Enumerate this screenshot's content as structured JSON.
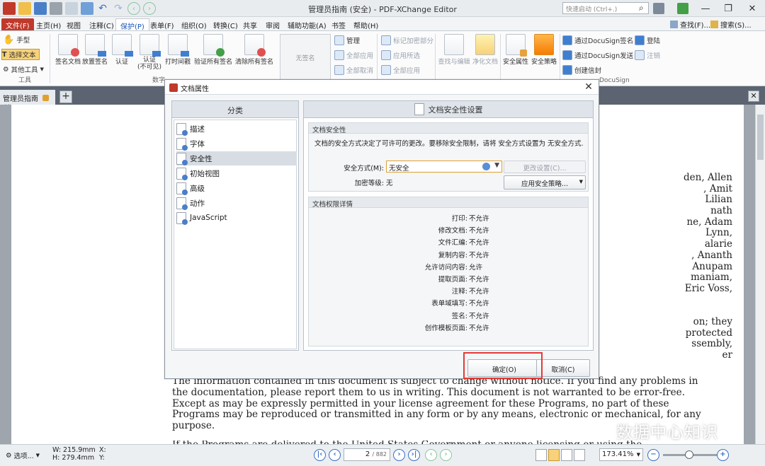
{
  "window": {
    "title": "管理员指南 (安全) - PDF-XChange Editor",
    "quick_search_placeholder": "快速启动 (Ctrl+.)"
  },
  "menu": {
    "items": [
      "文件(F)",
      "主页(H)",
      "视图",
      "注释(C)",
      "保护(P)",
      "表单(F)",
      "组织(O)",
      "转换(C)",
      "共享",
      "审阅",
      "辅助功能(A)",
      "书签",
      "帮助(H)"
    ],
    "active": "保护(P)",
    "find_label": "查找(F)...",
    "search_label": "搜索(S)..."
  },
  "ribbon": {
    "tools": {
      "hand": "手型",
      "select_text": "选择文本",
      "other_tools": "其他工具",
      "group": "工具"
    },
    "sign": {
      "sign_doc": "签名文档",
      "place_sig": "放置签名",
      "certify": "认证",
      "certify_invisible_1": "认证",
      "certify_invisible_2": "(不可见)",
      "timestamp": "打时间戳",
      "verify_all": "验证所有签名",
      "clear_all": "清除所有签名",
      "group": "数字"
    },
    "no_signature": "无签名",
    "manage": {
      "manage": "管理",
      "apply_all": "全部应用",
      "cancel_all": "全部取消"
    },
    "redact": {
      "mark": "标记加密部分",
      "apply_selected": "应用所选",
      "apply_all": "全部应用"
    },
    "find_edit": "查找与编辑",
    "sanitize": "净化文档",
    "security_props": "安全属性",
    "security_policy": "安全策略",
    "docusign": {
      "sign": "通过DocuSign签名",
      "send": "通过DocuSign发送",
      "create_envelope": "创建信封",
      "login": "登陆",
      "logout": "注销",
      "group": "DocuSign"
    }
  },
  "doc_tab": {
    "label": "管理员指南"
  },
  "document": {
    "side_lines": [
      "den, Allen",
      ", Amit",
      "Lilian",
      "nath",
      "ne, Adam",
      "Lynn,",
      "alarie",
      ", Ananth",
      "Anupam",
      "maniam,",
      "Eric Voss,",
      "",
      "",
      "on; they",
      "protected",
      "ssembly,",
      "er"
    ],
    "body_lines": [
      "The information contained in this document is subject to change without notice. If you find any problems in",
      "the documentation, please report them to us in writing. This document is not warranted to be error-free.",
      "Except as may be expressly permitted in your license agreement for these Programs, no part of these",
      "Programs may be reproduced or transmitted in any form or by any means, electronic or mechanical, for any",
      "purpose."
    ],
    "cut_line": "If the Programs are delivered to the United States Government or anyone licensing or using the Programs on"
  },
  "dialog": {
    "title": "文档属性",
    "category_header": "分类",
    "categories": [
      "描述",
      "字体",
      "安全性",
      "初始视图",
      "高级",
      "动作",
      "JavaScript"
    ],
    "selected_category": "安全性",
    "main_header": "文档安全性设置",
    "security": {
      "section_title": "文档安全性",
      "description": "文档的安全方式决定了可许可的更改。要移除安全限制，请将 安全方式设置为 无安全方式.",
      "method_label": "安全方式(M):",
      "method_value": "无安全",
      "encryption_label": "加密等级:",
      "encryption_value": "无",
      "change_settings": "更改设置(C)...",
      "apply_policy": "应用安全策略..."
    },
    "permissions": {
      "section_title": "文档权限详情",
      "rows": [
        {
          "key": "打印:",
          "value": "不允许"
        },
        {
          "key": "修改文档:",
          "value": "不允许"
        },
        {
          "key": "文件汇编:",
          "value": "不允许"
        },
        {
          "key": "复制内容:",
          "value": "不允许"
        },
        {
          "key": "允许访问内容:",
          "value": "允许"
        },
        {
          "key": "提取页面:",
          "value": "不允许"
        },
        {
          "key": "注释:",
          "value": "不允许"
        },
        {
          "key": "表单域填写:",
          "value": "不允许"
        },
        {
          "key": "签名:",
          "value": "不允许"
        },
        {
          "key": "创作模板页面:",
          "value": "不允许"
        }
      ]
    },
    "ok": "确定(O)",
    "cancel": "取消(C)"
  },
  "status": {
    "options": "选项...",
    "width": "W: 215.9mm",
    "height": "H: 279.4mm",
    "x": "X:",
    "y": "Y:",
    "page_current": "2",
    "page_total": "/ 882",
    "zoom": "173.41%"
  },
  "watermark": "数据中心知识",
  "colors": {
    "accent": "#1a56b8",
    "file_menu": "#c0392b",
    "highlight": "#e53935"
  }
}
